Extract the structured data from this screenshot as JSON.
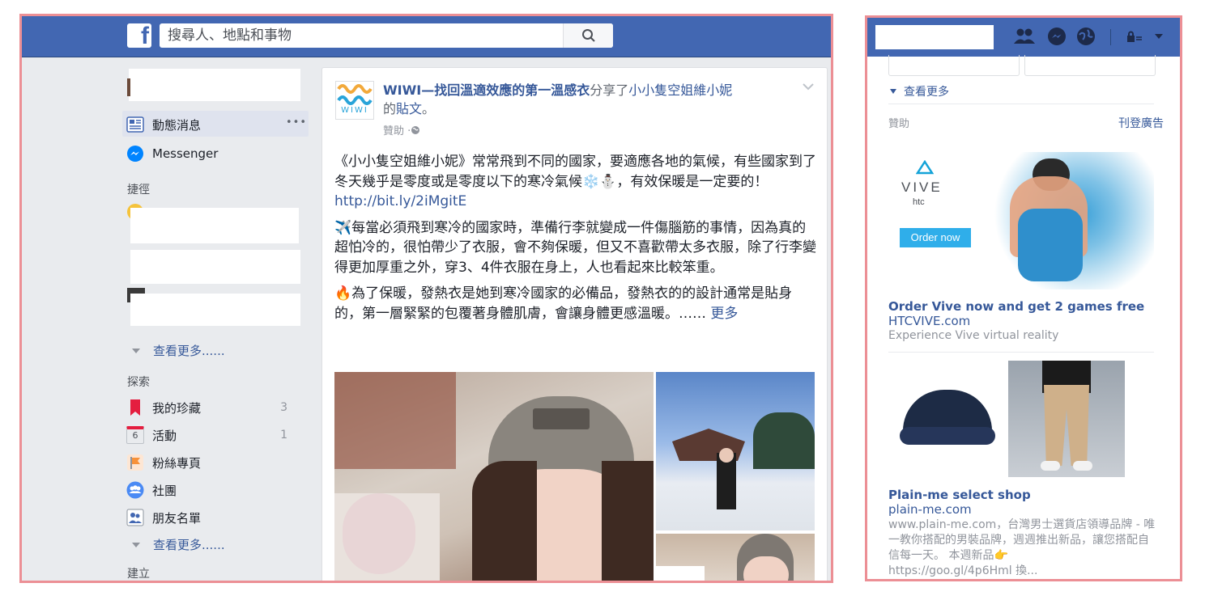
{
  "search": {
    "placeholder": "搜尋人、地點和事物"
  },
  "logo_letter": "f",
  "sidebar": {
    "news_feed": "動態消息",
    "news_feed_more": "•••",
    "messenger": "Messenger",
    "shortcuts_heading": "捷徑",
    "see_more": "查看更多......",
    "explore_heading": "探索",
    "explore": [
      {
        "label": "我的珍藏",
        "count": "3"
      },
      {
        "label": "活動",
        "count": "1",
        "icon_text": "6"
      },
      {
        "label": "粉絲專頁",
        "count": ""
      },
      {
        "label": "社團",
        "count": ""
      },
      {
        "label": "朋友名單",
        "count": ""
      }
    ],
    "see_more_2": "查看更多......",
    "create_heading": "建立"
  },
  "post": {
    "page_name": "WIWI—找回溫適效應的第一溫感衣",
    "shared_text": "分享了",
    "shared_from": "小小隻空姐維小妮",
    "possessive": "的",
    "post_word": "貼文",
    "period": "。",
    "sponsored": "贊助 · ",
    "logo_text": "WIWI",
    "p1": "《小小隻空姐維小妮》常常飛到不同的國家，要適應各地的氣候，有些國家到了冬天幾乎是零度或是零度以下的寒冷氣候❄️⛄，有效保暖是一定要的！",
    "p1_link": "http://bit.ly/2iMgitE",
    "p2": "✈️每當必須飛到寒冷的國家時，準備行李就變成一件傷腦筋的事情，因為真的超怕冷的，很怕帶少了衣服，會不夠保暖，但又不喜歡帶太多衣服，除了行李變得更加厚重之外，穿3、4件衣服在身上，人也看起來比較笨重。",
    "p3": "🔥為了保暖，發熱衣是她到寒冷國家的必備品，發熱衣的的設計通常是貼身的，第一層緊緊的包覆著身體肌膚，會讓身體更感溫暖。……",
    "more": "更多"
  },
  "right": {
    "see_more": "查看更多",
    "sponsored_heading": "贊助",
    "create_ad": "刊登廣告",
    "ad1": {
      "brand": "VIVE",
      "brand_sub": "htc",
      "cta": "Order now",
      "title": "Order Vive now and get 2 games free",
      "domain": "HTCVIVE.com",
      "desc": "Experience Vive virtual reality"
    },
    "ad2": {
      "title": "Plain-me select shop",
      "domain": "plain-me.com",
      "desc": "www.plain-me.com，台灣男士選貨店領導品牌 - 唯一教你搭配的男裝品牌，週週推出新品，讓您搭配自信每一天。 本週新品👉",
      "link": "https://goo.gl/4p6Hml 換..."
    }
  },
  "colors": {
    "brand": "#4267b2",
    "link": "#365899",
    "frame_border": "#ec8f95",
    "background": "#e9ebee"
  }
}
